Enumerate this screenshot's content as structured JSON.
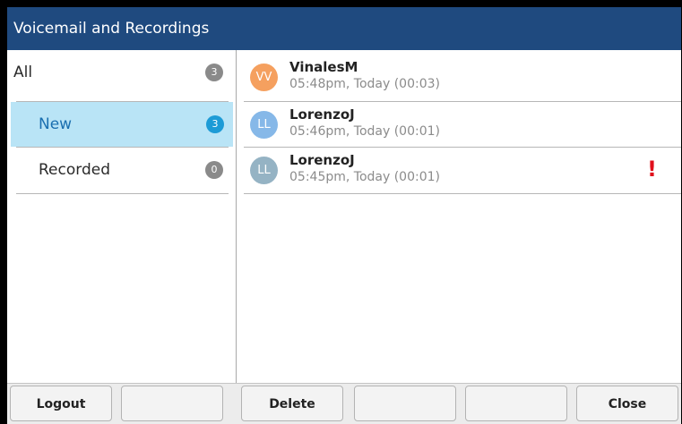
{
  "window": {
    "title": "Voicemail and Recordings"
  },
  "sidebar": {
    "items": [
      {
        "label": "All",
        "count": "3",
        "selected": false
      },
      {
        "label": "New",
        "count": "3",
        "selected": true
      },
      {
        "label": "Recorded",
        "count": "0",
        "selected": false
      }
    ]
  },
  "messages": [
    {
      "initials": "VV",
      "name": "VinalesM",
      "meta": "05:48pm, Today (00:03)",
      "avatar_color": "#f5a05f",
      "urgent": false
    },
    {
      "initials": "LL",
      "name": "LorenzoJ",
      "meta": "05:46pm, Today (00:01)",
      "avatar_color": "#86b8e8",
      "urgent": false
    },
    {
      "initials": "LL",
      "name": "LorenzoJ",
      "meta": "05:45pm, Today (00:01)",
      "avatar_color": "#95b3c4",
      "urgent": true,
      "urgent_symbol": "!"
    }
  ],
  "softkeys": [
    {
      "label": "Logout"
    },
    {
      "label": ""
    },
    {
      "label": "Delete"
    },
    {
      "label": ""
    },
    {
      "label": ""
    },
    {
      "label": "Close"
    }
  ],
  "colors": {
    "titlebar": "#1f4a7f",
    "selected_bg": "#b9e4f6",
    "selected_badge": "#1d9bd6",
    "urgent": "#e0101c"
  }
}
